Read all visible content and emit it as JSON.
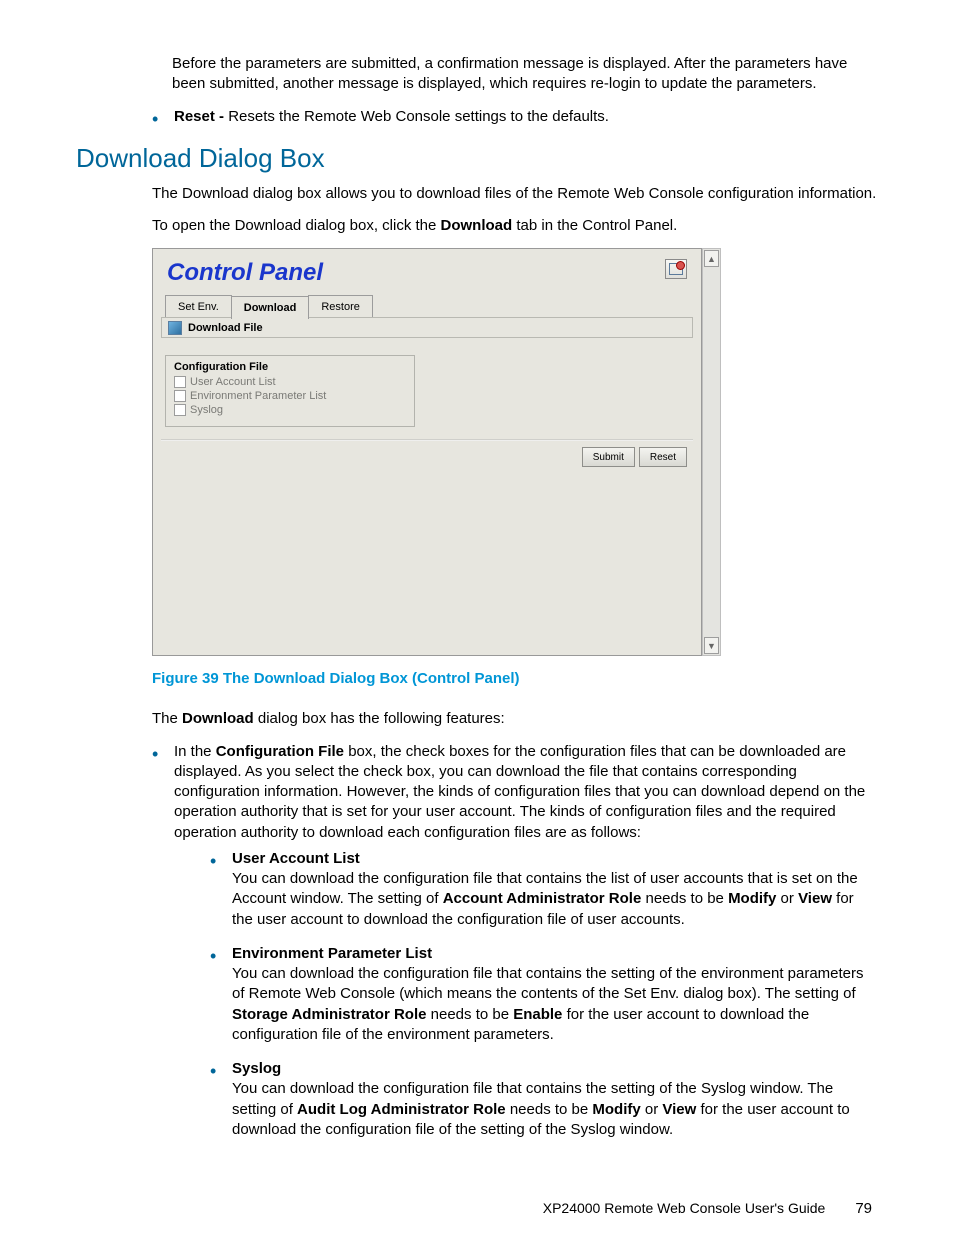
{
  "intro_para": "Before the parameters are submitted, a confirmation message is displayed. After the parameters have been submitted, another message is displayed, which requires re-login to update the parameters.",
  "reset_bullet_label": "Reset - ",
  "reset_bullet_text": "Resets the Remote Web Console settings to the defaults.",
  "section_heading": "Download Dialog Box",
  "para1": "The Download dialog box allows you to download files of the Remote Web Console configuration information.",
  "para2_pre": "To open the Download dialog box, click the ",
  "para2_bold": "Download",
  "para2_post": " tab in the Control Panel.",
  "screenshot": {
    "title": "Control Panel",
    "tabs": [
      "Set Env.",
      "Download",
      "Restore"
    ],
    "active_tab_index": 1,
    "subheader": "Download File",
    "fieldset_legend": "Configuration File",
    "checks": [
      "User Account List",
      "Environment Parameter List",
      "Syslog"
    ],
    "btn_submit": "Submit",
    "btn_reset": "Reset"
  },
  "figure_caption": "Figure 39 The Download Dialog Box (Control Panel)",
  "para3_pre": "The ",
  "para3_bold": "Download",
  "para3_post": " dialog box has the following features:",
  "config_bullet": {
    "pre": "In the ",
    "bold": "Configuration File",
    "post": " box, the check boxes for the configuration files that can be downloaded are displayed. As you select the check box, you can download the file that contains corresponding configuration information. However, the kinds of configuration files that you can download depend on the operation authority that is set for your user account. The kinds of configuration files and the required operation authority to download each configuration files are as follows:"
  },
  "sub1": {
    "title": "User Account List",
    "t1": "You can download the configuration file that contains the list of user accounts that is set on the Account window. The setting of ",
    "b1": "Account Administrator Role",
    "t2": " needs to be ",
    "b2": "Modify",
    "t3": " or ",
    "b3": "View",
    "t4": " for the user account to download the configuration file of user accounts."
  },
  "sub2": {
    "title": "Environment Parameter List",
    "t1": "You can download the configuration file that contains the setting of the environment parameters of Remote Web Console (which means the contents of the Set Env. dialog box). The setting of ",
    "b1": "Storage Administrator Role",
    "t2": " needs to be ",
    "b2": "Enable",
    "t3": " for the user account to download the configuration file of the environment parameters."
  },
  "sub3": {
    "title": "Syslog",
    "t1": "You can download the configuration file that contains the setting of the Syslog window. The setting of ",
    "b1": "Audit Log Administrator Role",
    "t2": " needs to be ",
    "b2": "Modify",
    "t3": " or ",
    "b3": "View",
    "t4": " for the user account to download the configuration file of the setting of the Syslog window."
  },
  "footer_guide": "XP24000 Remote Web Console User's Guide",
  "footer_page": "79"
}
